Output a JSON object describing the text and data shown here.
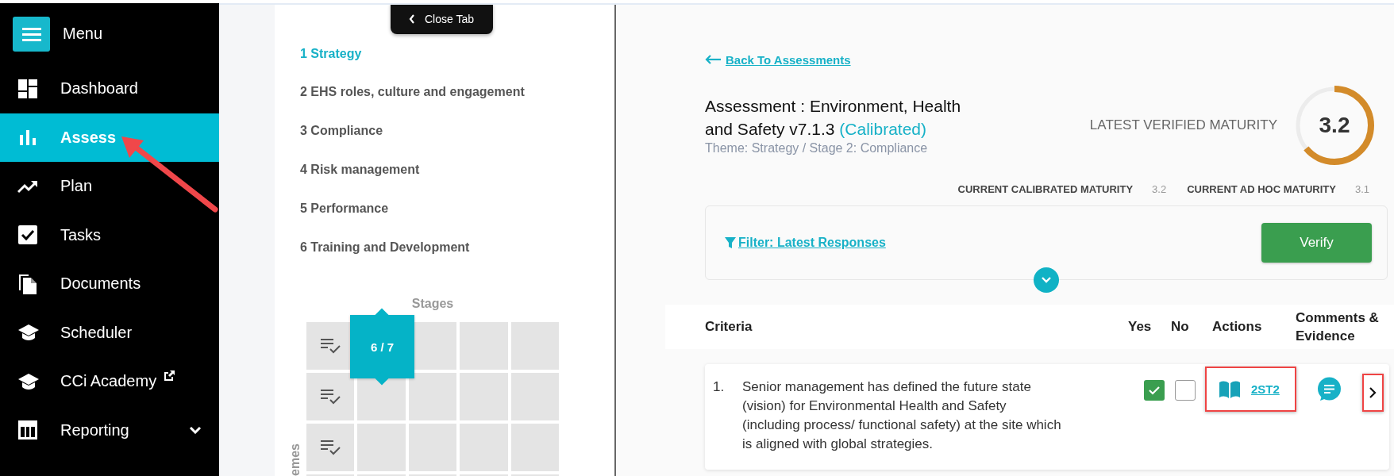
{
  "sidebar": {
    "menu_label": "Menu",
    "items": [
      {
        "label": "Dashboard",
        "kind": "dashboard",
        "selected": false,
        "annotated": false
      },
      {
        "label": "Assess",
        "kind": "bars",
        "selected": true,
        "annotated": true
      },
      {
        "label": "Plan",
        "kind": "trend",
        "selected": false,
        "annotated": false
      },
      {
        "label": "Tasks",
        "kind": "check",
        "selected": false,
        "annotated": false
      },
      {
        "label": "Documents",
        "kind": "documents",
        "selected": false,
        "annotated": false
      },
      {
        "label": "Scheduler",
        "kind": "cap",
        "selected": false,
        "annotated": false
      },
      {
        "label": "CCi Academy",
        "kind": "cap",
        "selected": false,
        "annotated": false,
        "external": true
      },
      {
        "label": "Reporting",
        "kind": "table",
        "selected": false,
        "annotated": false,
        "expandable": true
      }
    ]
  },
  "theme_panel": {
    "close_tab": "Close Tab",
    "themes": [
      {
        "label": "1 Strategy",
        "selected": true
      },
      {
        "label": "2 EHS roles, culture and engagement",
        "selected": false
      },
      {
        "label": "3 Compliance",
        "selected": false
      },
      {
        "label": "4 Risk management",
        "selected": false
      },
      {
        "label": "5 Performance",
        "selected": false
      },
      {
        "label": "6 Training and Development",
        "selected": false
      }
    ],
    "stages_label": "Stages",
    "axis_label": "emes",
    "badge": "6 / 7"
  },
  "back_link": "Back To Assessments",
  "assessment": {
    "title": "Assessment : Environment, Health and Safety v7.1.3",
    "status": "(Calibrated)",
    "subtitle": "Theme: Strategy / Stage 2: Compliance"
  },
  "maturity": {
    "label": "LATEST VERIFIED MATURITY",
    "value": "3.2",
    "level": 0.64
  },
  "current_maturity": [
    {
      "label": "CURRENT CALIBRATED MATURITY",
      "value": "3.2"
    },
    {
      "label": "CURRENT AD HOC MATURITY",
      "value": "3.1"
    }
  ],
  "filter": {
    "label": "Filter: Latest Responses",
    "button": "Verify"
  },
  "table": {
    "columns": [
      "Criteria",
      "Yes",
      "No",
      "Actions",
      "Comments & Evidence"
    ],
    "rows": [
      {
        "number": "1.",
        "text": "Senior management has defined the future state (vision) for Environmental Health and Safety (including process/ functional safety) at the site which is aligned with global strategies.",
        "yes_checked": true,
        "no_checked": false,
        "action": "2ST2",
        "action_highlighted": true,
        "next_highlighted": true
      }
    ]
  }
}
